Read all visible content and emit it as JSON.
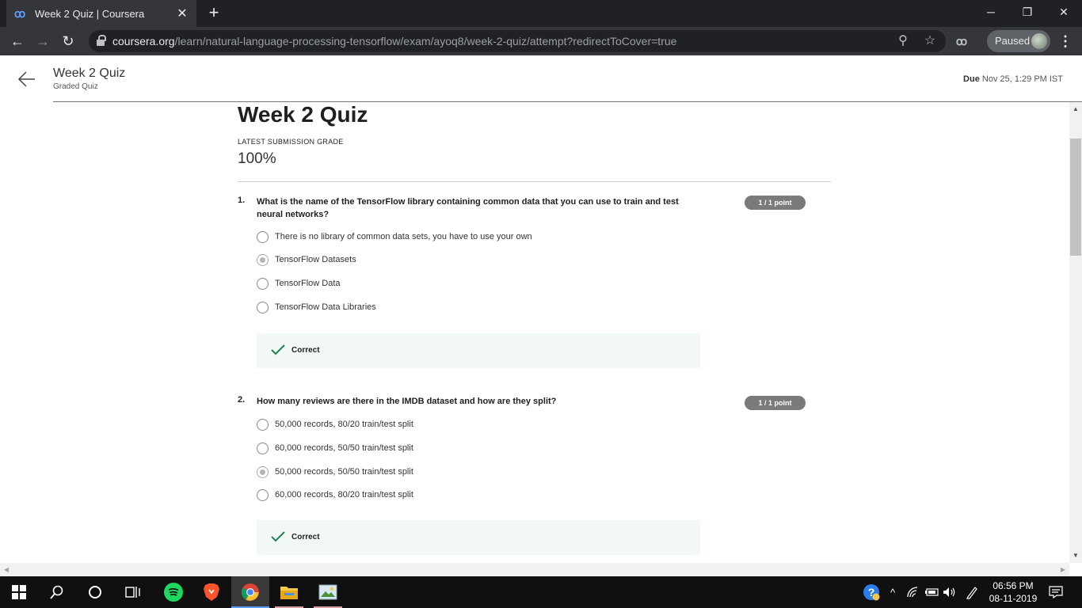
{
  "browser": {
    "tab_title": "Week 2 Quiz | Coursera",
    "url_host": "coursera.org",
    "url_path": "/learn/natural-language-processing-tensorflow/exam/ayoq8/week-2-quiz/attempt?redirectToCover=true",
    "profile_status": "Paused"
  },
  "header": {
    "title": "Week 2 Quiz",
    "subtitle": "Graded Quiz",
    "due_label": "Due",
    "due_value": "Nov 25, 1:29 PM IST"
  },
  "quiz": {
    "title": "Week 2 Quiz",
    "grade_label": "LATEST SUBMISSION GRADE",
    "grade_value": "100%",
    "questions": [
      {
        "number": "1.",
        "text": "What is the name of the TensorFlow library containing common data that you can use to train and test neural networks?",
        "points": "1 / 1 point",
        "options": [
          {
            "label": "There is no library of common data sets, you have to use your own",
            "selected": false
          },
          {
            "label": "TensorFlow Datasets",
            "selected": true
          },
          {
            "label": "TensorFlow Data",
            "selected": false
          },
          {
            "label": "TensorFlow Data Libraries",
            "selected": false
          }
        ],
        "feedback": "Correct"
      },
      {
        "number": "2.",
        "text": "How many reviews are there in the IMDB dataset and how are they split?",
        "points": "1 / 1 point",
        "options": [
          {
            "label": "50,000 records, 80/20 train/test split",
            "selected": false
          },
          {
            "label": "60,000 records, 50/50 train/test split",
            "selected": false
          },
          {
            "label": "50,000 records, 50/50 train/test split",
            "selected": true
          },
          {
            "label": "60,000 records, 80/20 train/test split",
            "selected": false
          }
        ],
        "feedback": "Correct"
      }
    ]
  },
  "taskbar": {
    "time": "06:56 PM",
    "date": "08-11-2019",
    "icons": [
      "windows-start-icon",
      "search-icon",
      "cortana-icon",
      "task-view-icon",
      "spotify-icon",
      "brave-icon",
      "chrome-icon",
      "file-explorer-icon",
      "photos-icon"
    ]
  },
  "colors": {
    "accent_green": "#1f8354",
    "feedback_bg": "#f2f8f5",
    "points_badge": "#7a7a7a",
    "chrome_dark": "#202124"
  }
}
